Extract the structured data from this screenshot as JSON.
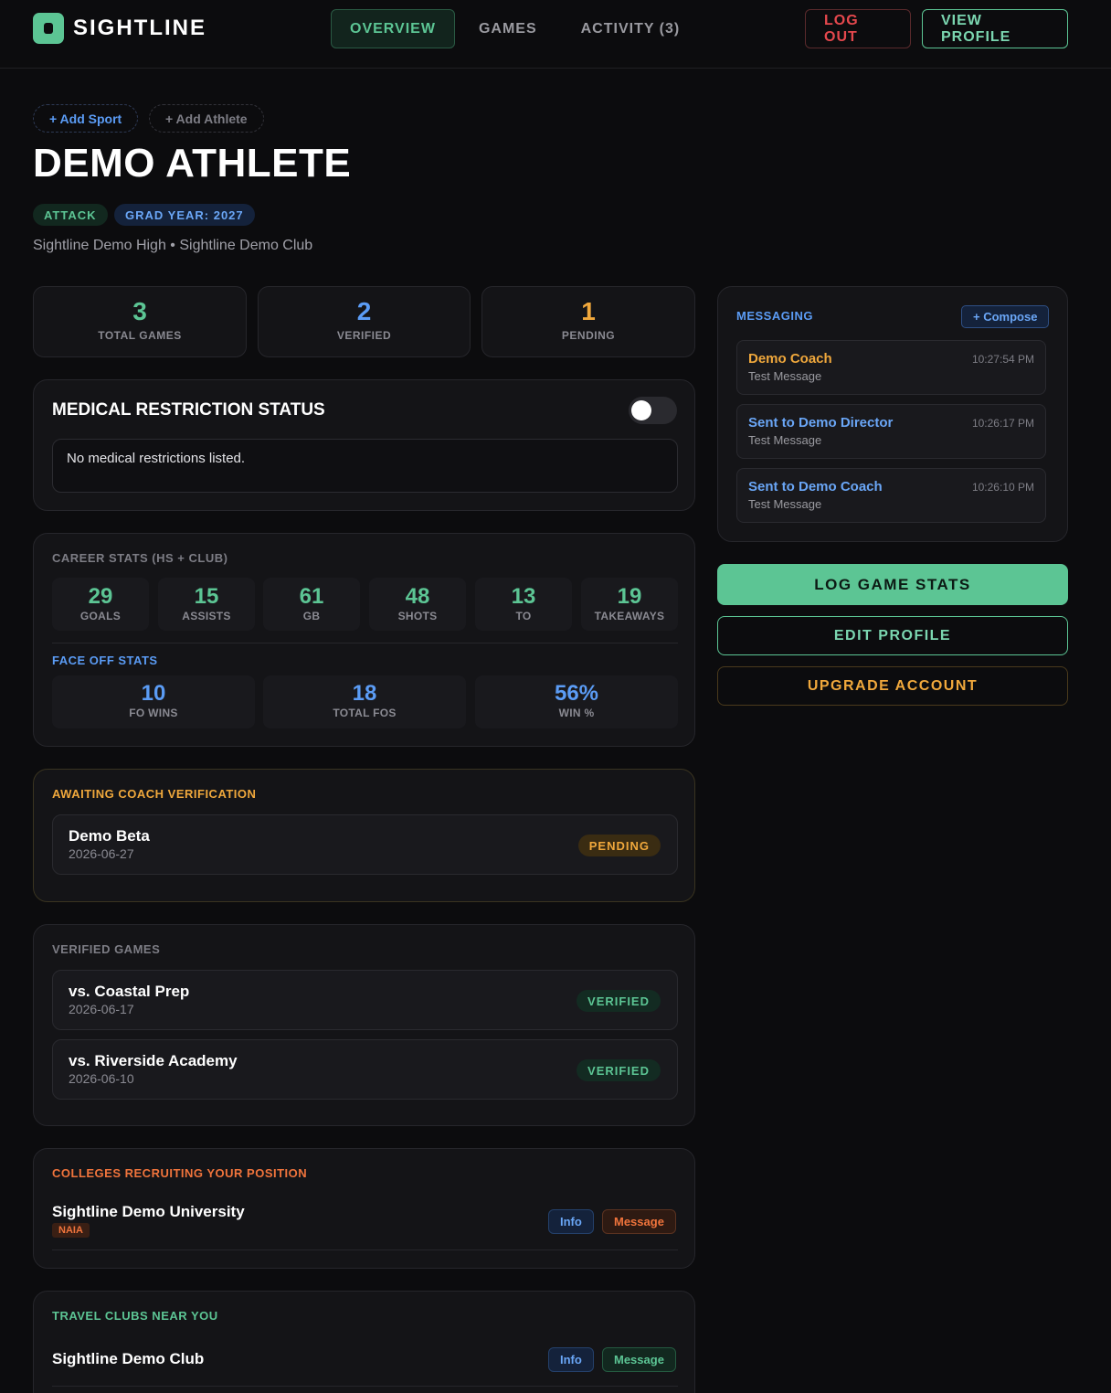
{
  "brand": {
    "name": "SIGHTLINE"
  },
  "nav": {
    "tabs": [
      "OVERVIEW",
      "GAMES",
      "ACTIVITY (3)"
    ],
    "logout": "LOG OUT",
    "view_profile": "VIEW PROFILE"
  },
  "header": {
    "add_sport": "+ Add Sport",
    "add_athlete": "+ Add Athlete",
    "athlete_name": "DEMO ATHLETE",
    "position": "ATTACK",
    "grad_year": "GRAD YEAR: 2027",
    "schools": "Sightline Demo High • Sightline Demo Club"
  },
  "summary": [
    {
      "value": "3",
      "label": "TOTAL GAMES",
      "color": "#5cc594"
    },
    {
      "value": "2",
      "label": "VERIFIED",
      "color": "#5b9cf5"
    },
    {
      "value": "1",
      "label": "PENDING",
      "color": "#f0a83c"
    }
  ],
  "medical": {
    "title": "MEDICAL RESTRICTION STATUS",
    "toggle_on": false,
    "text": "No medical restrictions listed."
  },
  "career": {
    "label": "CAREER STATS (HS + CLUB)",
    "stats": [
      {
        "value": "29",
        "label": "GOALS"
      },
      {
        "value": "15",
        "label": "ASSISTS"
      },
      {
        "value": "61",
        "label": "GB"
      },
      {
        "value": "48",
        "label": "SHOTS"
      },
      {
        "value": "13",
        "label": "TO"
      },
      {
        "value": "19",
        "label": "TAKEAWAYS"
      }
    ],
    "faceoff_label": "FACE OFF STATS",
    "faceoff": [
      {
        "value": "10",
        "label": "FO WINS"
      },
      {
        "value": "18",
        "label": "TOTAL FOS"
      },
      {
        "value": "56%",
        "label": "WIN %"
      }
    ]
  },
  "awaiting": {
    "label": "AWAITING COACH VERIFICATION",
    "games": [
      {
        "name": "Demo Beta",
        "date": "2026-06-27",
        "status": "PENDING"
      }
    ]
  },
  "verified": {
    "label": "VERIFIED GAMES",
    "games": [
      {
        "name": "vs. Coastal Prep",
        "date": "2026-06-17",
        "status": "VERIFIED"
      },
      {
        "name": "vs. Riverside Academy",
        "date": "2026-06-10",
        "status": "VERIFIED"
      }
    ]
  },
  "colleges": {
    "label": "COLLEGES RECRUITING YOUR POSITION",
    "items": [
      {
        "name": "Sightline Demo University",
        "tag": "NAIA",
        "info": "Info",
        "message": "Message"
      }
    ]
  },
  "clubs": {
    "label": "TRAVEL CLUBS NEAR YOU",
    "items": [
      {
        "name": "Sightline Demo Club",
        "info": "Info",
        "message": "Message"
      }
    ]
  },
  "messaging": {
    "label": "MESSAGING",
    "compose": "+ Compose",
    "messages": [
      {
        "from": "Demo Coach",
        "body": "Test Message",
        "time": "10:27:54 PM"
      },
      {
        "from": "Sent to Demo Director",
        "body": "Test Message",
        "time": "10:26:17 PM"
      },
      {
        "from": "Sent to Demo Coach",
        "body": "Test Message",
        "time": "10:26:10 PM"
      }
    ]
  },
  "actions": {
    "log_game_stats": "LOG GAME STATS",
    "edit_profile": "EDIT PROFILE",
    "upgrade_account": "UPGRADE ACCOUNT"
  }
}
